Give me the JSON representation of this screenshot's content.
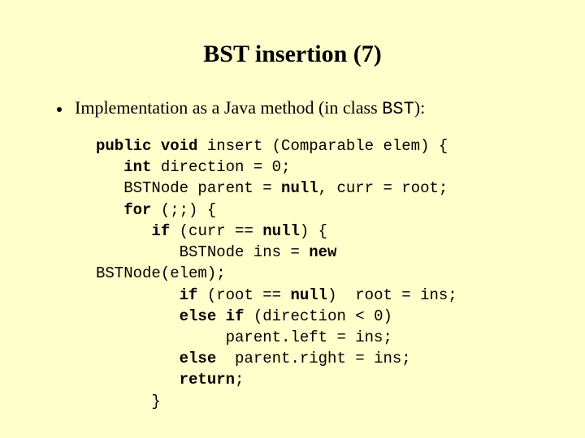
{
  "title": "BST insertion (7)",
  "bullet": {
    "pre": "Implementation as a Java method (in class ",
    "mono": "BST",
    "post": "):"
  },
  "code": {
    "kw_public": "public",
    "kw_void": "void",
    "sig_rest": " insert (Comparable elem) {",
    "kw_int": "int",
    "l2_rest": " direction = 0;",
    "l3_a": "   BSTNode parent = ",
    "kw_null1": "null",
    "l3_b": ", curr = root;",
    "kw_for": "for",
    "l4_rest": " (;;) {",
    "kw_if1": "if",
    "l5_a": " (curr == ",
    "kw_null2": "null",
    "l5_b": ") {",
    "l6_a": "         BSTNode ins = ",
    "kw_new": "new",
    "l7": "BSTNode(elem);",
    "kw_if2": "if",
    "l8_a": " (root == ",
    "kw_null3": "null",
    "l8_b": ")  root = ins;",
    "kw_else1": "else",
    "kw_if3": "if",
    "l9_rest": " (direction < 0)",
    "l10": "              parent.left = ins;",
    "kw_else2": "else",
    "l11_rest": "  parent.right = ins;",
    "kw_return": "return",
    "semicolon": ";",
    "l13": "      }",
    "ind3": "   ",
    "ind6": "      ",
    "ind9": "         ",
    "sp": " "
  }
}
